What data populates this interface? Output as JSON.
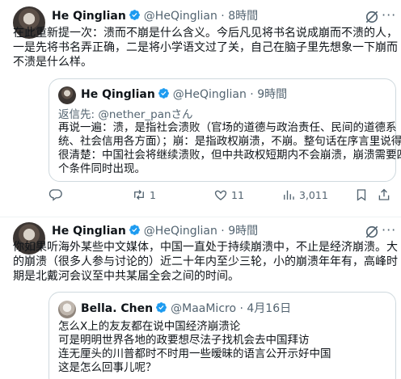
{
  "posts": [
    {
      "author": "He Qinglian",
      "handle": "@HeQinglian",
      "dot": "·",
      "time": "8時間",
      "text_lines": [
        "在此重新提一次：溃而不崩是什么含义。今后凡见将书名说成崩而不溃的人，",
        "一是先将书名弄正确，二是将小学语文过了关，自己在脑子里先想象一下崩而",
        "不溃是什么样。"
      ],
      "quote": {
        "author": "He Qinglian",
        "handle": "@HeQinglian",
        "dot": "·",
        "time": "9時間",
        "reply_to": "返信先: @nether_panさん",
        "text_lines": [
          "再说一遍：溃，是指社会溃败（官场的道德与政治责任、民间的道德系",
          "统、社会信用各方面）；崩：是指政权崩溃，不崩。整句话在序言里说得",
          "很清楚：中国社会将继续溃败，但中共政权短期内不会崩溃，崩溃需要四",
          "个条件同时出现。"
        ]
      },
      "actions": {
        "reply_count": "",
        "repost_count": "1",
        "like_count": "11",
        "views_count": "3,011"
      }
    },
    {
      "author": "He Qinglian",
      "handle": "@HeQinglian",
      "dot": "·",
      "time": "9時間",
      "text_lines": [
        "你如果听海外某些中文媒体，中国一直处于持续崩溃中，不止是经济崩溃。大",
        "的崩溃（很多人参与讨论的）近二十年内至少三轮，小的崩溃年年有，高峰时",
        "期是北戴河会议至中共某届全会之间的时间。"
      ],
      "quote": {
        "author": "Bella. Chen",
        "handle": "@MaaMicro",
        "dot": "·",
        "time": "4月16日",
        "text_lines": [
          "怎么X上的友友都在说中国经济崩溃论",
          "可是明明世界各地的政要想尽法子找机会去中国拜访",
          "连无厘头的川普都时不时用一些暧昧的语言公开示好中国",
          "这是怎么回事儿呢？"
        ]
      }
    }
  ],
  "colors": {
    "verified": "#1d9bf0",
    "secondary_text": "#536471",
    "border": "#cfd9de"
  },
  "icons": {
    "verified": "verified-badge-icon",
    "grok": "grok-icon",
    "more": "more-icon",
    "reply": "reply-icon",
    "repost": "repost-icon",
    "like": "like-icon",
    "views": "views-icon",
    "bookmark": "bookmark-icon",
    "share": "share-icon"
  },
  "more_glyph": "···"
}
